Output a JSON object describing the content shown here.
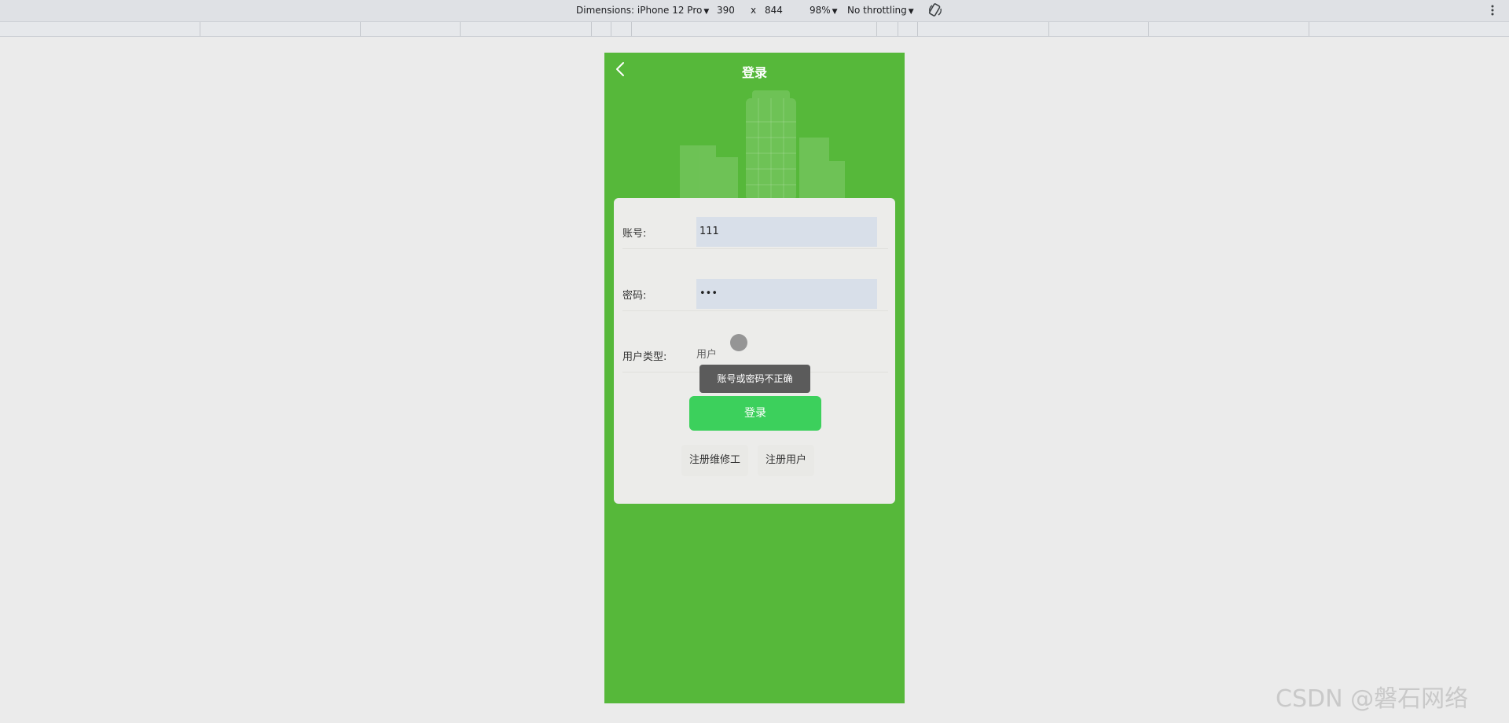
{
  "devtools": {
    "dimensions_label": "Dimensions: iPhone 12 Pro",
    "width": "390",
    "times": "x",
    "height": "844",
    "zoom": "98%",
    "throttling": "No throttling",
    "caret": "▼"
  },
  "nav": {
    "title": "登录",
    "back_icon": "chevron-left-icon"
  },
  "form": {
    "account_label": "账号:",
    "account_value": "111",
    "password_label": "密码:",
    "password_value": "•••",
    "usertype_label": "用户类型:",
    "usertype_value": "用户"
  },
  "toast": {
    "message": "账号或密码不正确"
  },
  "buttons": {
    "login": "登录",
    "register_repairer": "注册维修工",
    "register_user": "注册用户"
  },
  "watermark": "CSDN @磐石网络",
  "colors": {
    "primary_green": "#56b83a",
    "button_green": "#3cd05c",
    "card_bg": "#ececea",
    "input_bg": "#d8dfe9",
    "toast_bg": "#5b5b5b"
  }
}
